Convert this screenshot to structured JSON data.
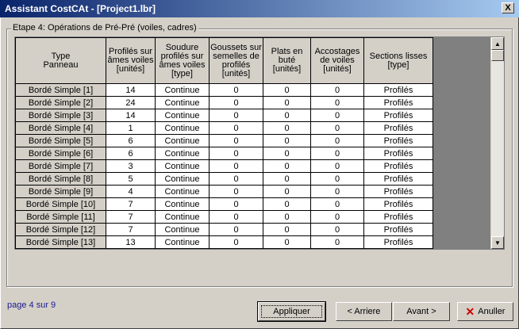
{
  "window": {
    "title": "Assistant CostCAt - [Project1.lbr]",
    "close_glyph": "X"
  },
  "group": {
    "label": "Etape 4: Opérations de Pré-Pré (voiles, cadres)"
  },
  "table": {
    "headers": [
      "Type\nPanneau",
      "Profilés sur âmes voiles [unités]",
      "Soudure profilés sur âmes voiles [type]",
      "Goussets sur semelles de profilés [unités]",
      "Plats en buté [unités]",
      "Accostages de voiles [unités]",
      "Sections lisses [type]"
    ],
    "rows": [
      [
        "Bordé Simple [1]",
        "14",
        "Continue",
        "0",
        "0",
        "0",
        "Profilés"
      ],
      [
        "Bordé Simple [2]",
        "24",
        "Continue",
        "0",
        "0",
        "0",
        "Profilés"
      ],
      [
        "Bordé Simple [3]",
        "14",
        "Continue",
        "0",
        "0",
        "0",
        "Profilés"
      ],
      [
        "Bordé Simple [4]",
        "1",
        "Continue",
        "0",
        "0",
        "0",
        "Profilés"
      ],
      [
        "Bordé Simple [5]",
        "6",
        "Continue",
        "0",
        "0",
        "0",
        "Profilés"
      ],
      [
        "Bordé Simple [6]",
        "6",
        "Continue",
        "0",
        "0",
        "0",
        "Profilés"
      ],
      [
        "Bordé Simple [7]",
        "3",
        "Continue",
        "0",
        "0",
        "0",
        "Profilés"
      ],
      [
        "Bordé Simple [8]",
        "5",
        "Continue",
        "0",
        "0",
        "0",
        "Profilés"
      ],
      [
        "Bordé Simple [9]",
        "4",
        "Continue",
        "0",
        "0",
        "0",
        "Profilés"
      ],
      [
        "Bordé Simple [10]",
        "7",
        "Continue",
        "0",
        "0",
        "0",
        "Profilés"
      ],
      [
        "Bordé Simple [11]",
        "7",
        "Continue",
        "0",
        "0",
        "0",
        "Profilés"
      ],
      [
        "Bordé Simple [12]",
        "7",
        "Continue",
        "0",
        "0",
        "0",
        "Profilés"
      ],
      [
        "Bordé Simple [13]",
        "13",
        "Continue",
        "0",
        "0",
        "0",
        "Profilés"
      ]
    ]
  },
  "footer": {
    "page_label": "page 4 sur 9",
    "apply": "Appliquer",
    "back": "< Arriere",
    "next": "Avant >",
    "cancel": "Anuller"
  }
}
